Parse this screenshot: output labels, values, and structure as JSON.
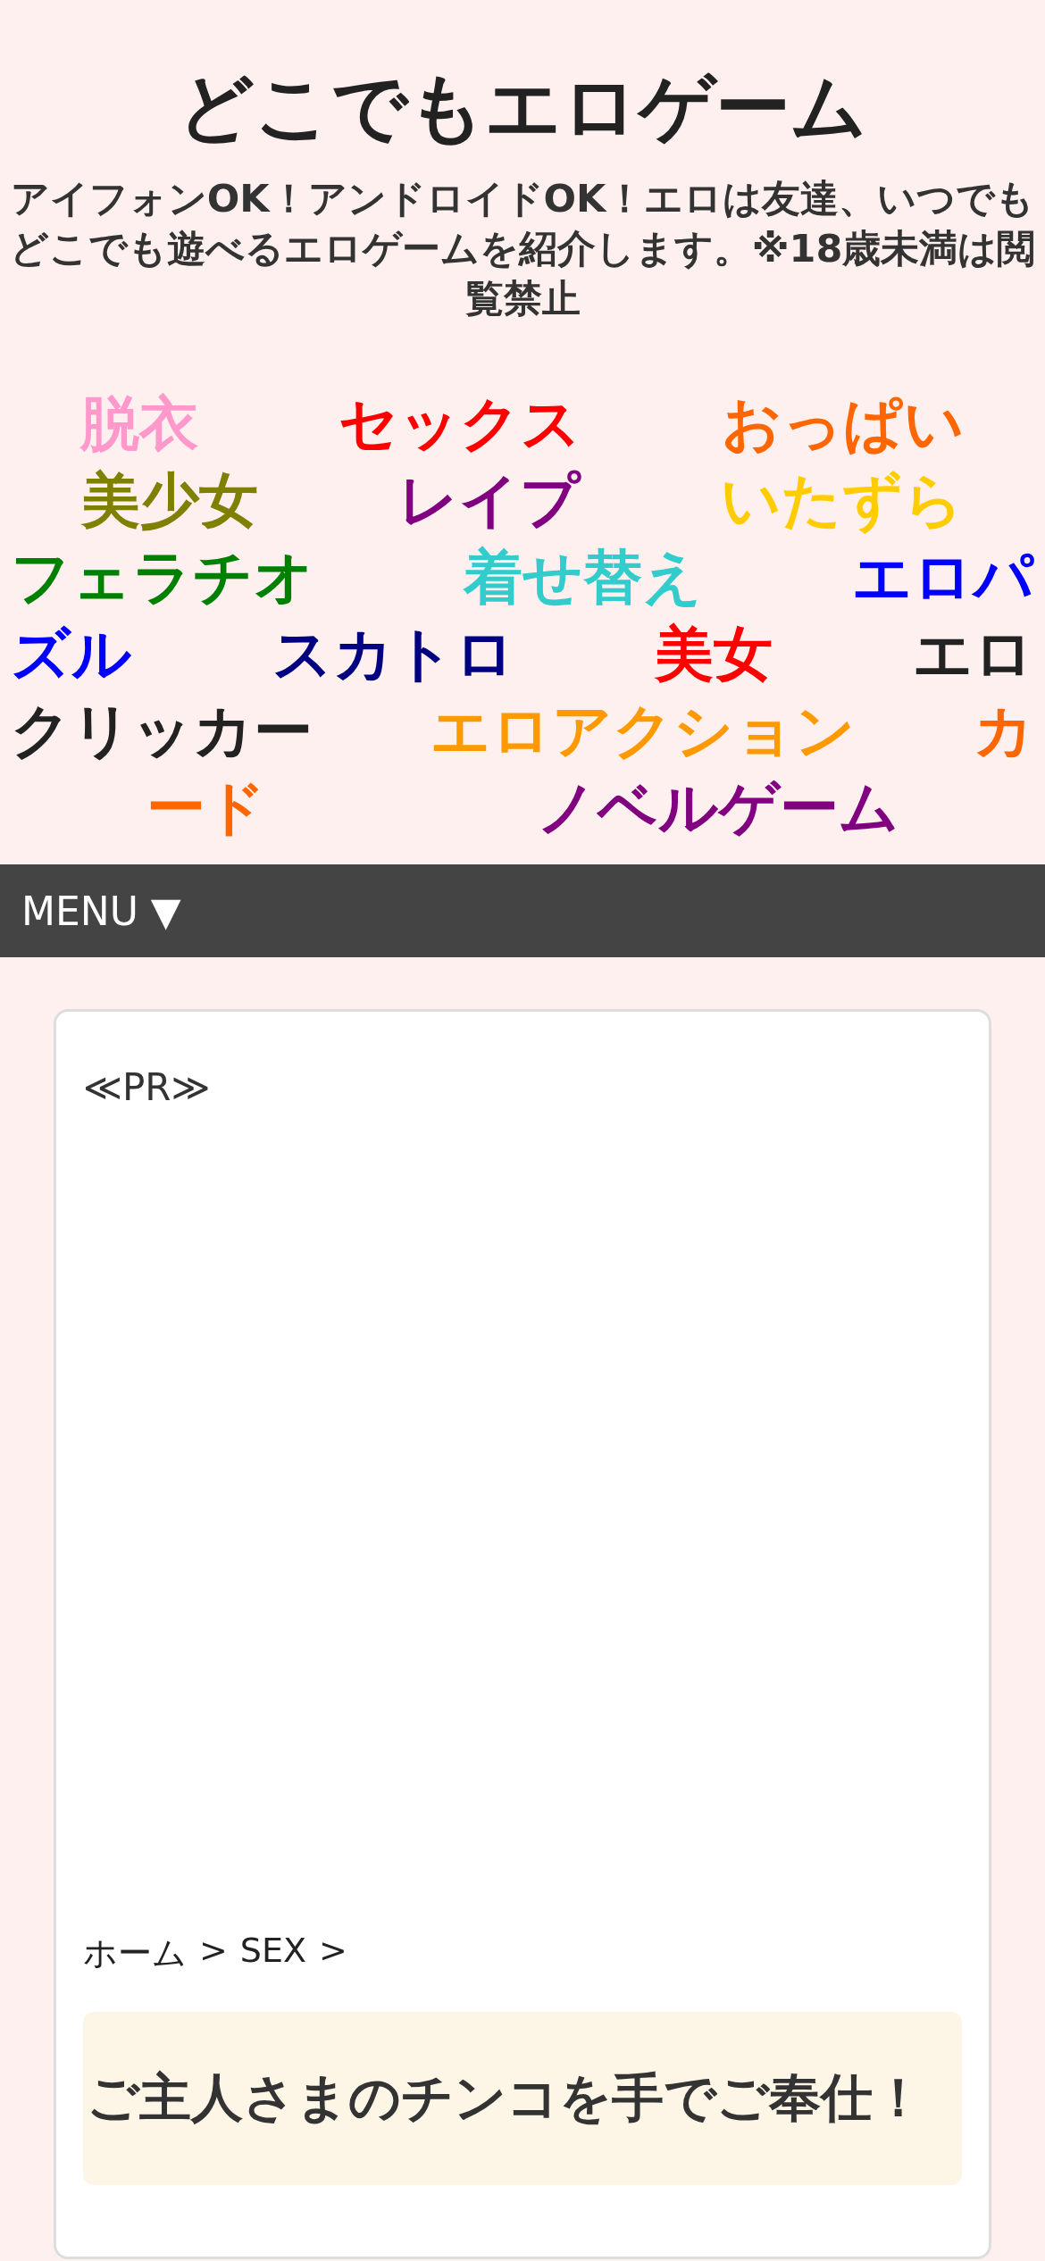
{
  "site": {
    "title": "どこでもエロゲーム",
    "description": "アイフォンOK！アンドロイドOK！エロは友達、いつでもどこでも遊べるエロゲームを紹介します。※18歳未満は閲覧禁止"
  },
  "tag_rows": [
    [
      {
        "label": "脱衣",
        "color": "#ff99cc"
      },
      {
        "label": "セックス",
        "color": "#ff0000"
      },
      {
        "label": "おっぱい",
        "color": "#ff6600"
      }
    ],
    [
      {
        "label": "美少女",
        "color": "#808000"
      },
      {
        "label": "レイプ",
        "color": "#800080"
      },
      {
        "label": "いたずら",
        "color": "#ffcc00"
      }
    ],
    [
      {
        "label": "フェラチオ",
        "color": "#008000"
      },
      {
        "label": "着せ替え",
        "color": "#33cccc"
      },
      {
        "label": "エロパ",
        "color": "#0000ff"
      }
    ],
    [
      {
        "label": "ズル",
        "color": "#0000ff"
      },
      {
        "label": "スカトロ",
        "color": "#000080"
      },
      {
        "label": "美女",
        "color": "#ff0000"
      },
      {
        "label": "エロ",
        "color": "#222222"
      }
    ],
    [
      {
        "label": "クリッカー",
        "color": "#222222"
      },
      {
        "label": "エロアクション",
        "color": "#ff9900"
      },
      {
        "label": "カ",
        "color": "#ff6600"
      }
    ],
    [
      {
        "label": "ード",
        "color": "#ff6600"
      },
      {
        "label": "ノベルゲーム",
        "color": "#800080"
      }
    ]
  ],
  "menu": {
    "label": "MENU ▼"
  },
  "article": {
    "ad_label": "≪PR≫",
    "breadcrumb": [
      "ホーム",
      ">",
      "SEX",
      ">"
    ],
    "title": "ご主人さまのチンコを手でご奉仕！"
  }
}
